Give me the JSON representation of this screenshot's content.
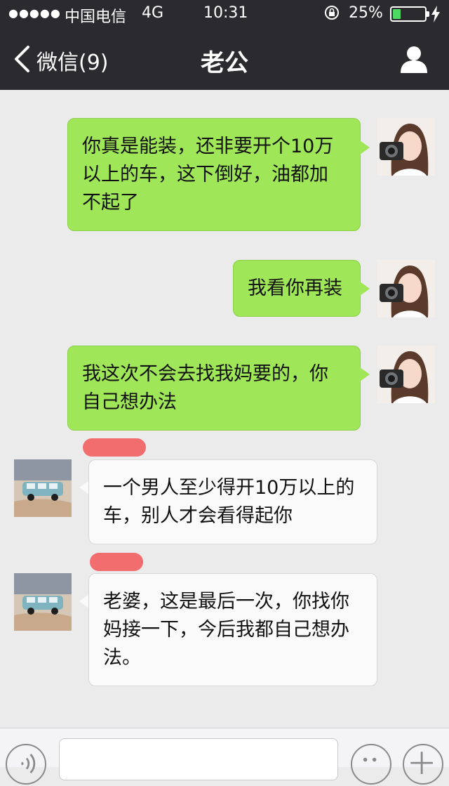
{
  "status_bar": {
    "signal_dots": "●●●●●",
    "carrier": "中国电信",
    "network": "4G",
    "time": "10:31",
    "battery_percent": "25%",
    "battery_level": 0.25,
    "battery_color": "#4cd964"
  },
  "nav": {
    "back_label": "微信(9)",
    "title": "老公"
  },
  "messages": [
    {
      "sender": "me",
      "text": "你真是能装，还非要开个10万以上的车，这下倒好，油都加不起了"
    },
    {
      "sender": "me",
      "text": "我看你再装"
    },
    {
      "sender": "me",
      "text": "我这次不会去找我妈要的，你自己想办法"
    },
    {
      "sender": "them",
      "text": "一个男人至少得开10万以上的车，别人才会看得起你"
    },
    {
      "sender": "them",
      "text": "老婆，这是最后一次，你找你妈接一下，今后我都自己想办法。"
    }
  ],
  "colors": {
    "nav_bg": "#2b2b2f",
    "chat_bg": "#ebebeb",
    "my_bubble": "#9fe658",
    "their_bubble": "#fafafa",
    "redaction": "#f26d6d"
  },
  "icons": {
    "back": "chevron-left-icon",
    "profile": "user-icon",
    "voice": "voice-icon",
    "emoji": "emoji-icon",
    "more": "plus-icon"
  }
}
